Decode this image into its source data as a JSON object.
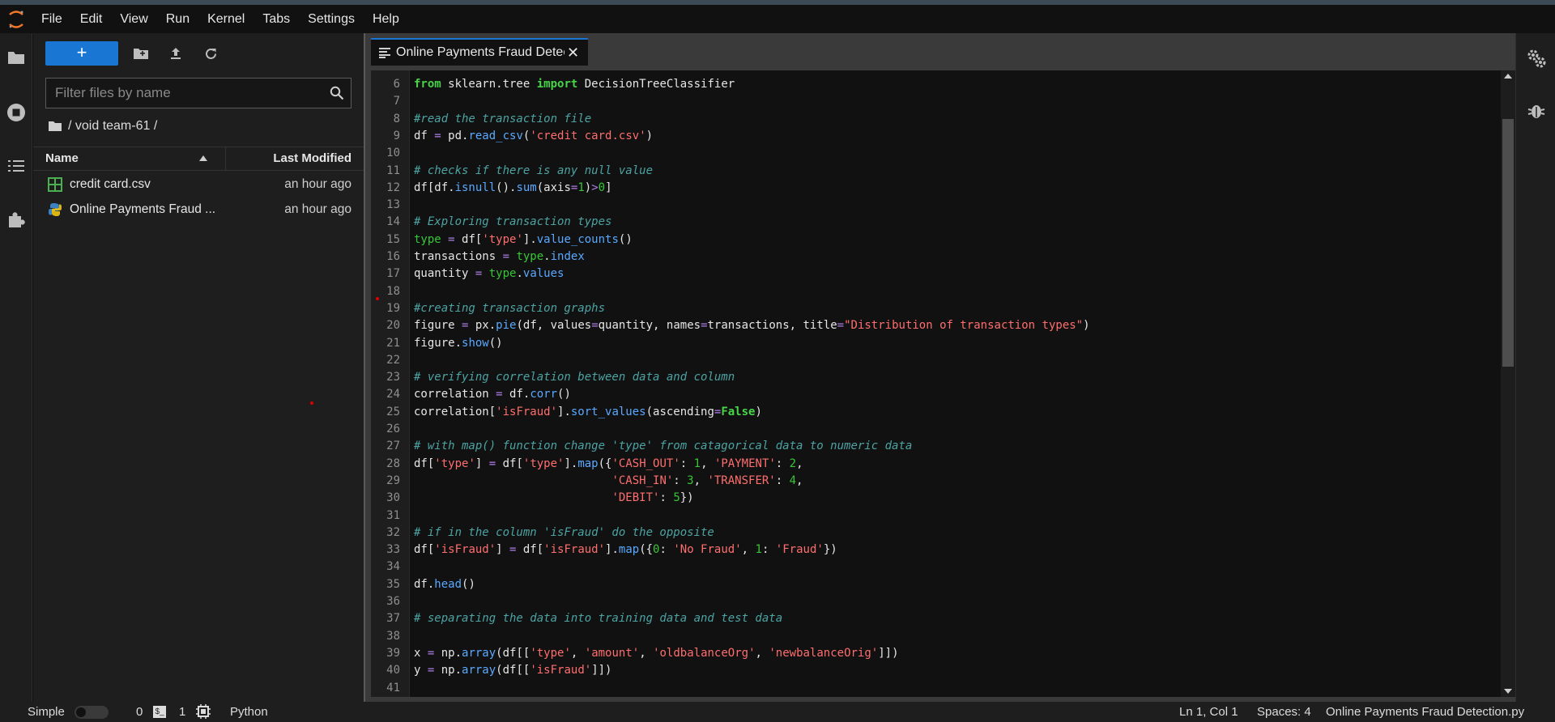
{
  "menubar": {
    "items": [
      "File",
      "Edit",
      "View",
      "Run",
      "Kernel",
      "Tabs",
      "Settings",
      "Help"
    ]
  },
  "filebrowser": {
    "new_label": "+",
    "filter_placeholder": "Filter files by name",
    "breadcrumb": "/ void team-61 /",
    "col_name": "Name",
    "col_modified": "Last Modified",
    "files": [
      {
        "name": "credit card.csv",
        "modified": "an hour ago",
        "icon": "csv-table-icon"
      },
      {
        "name": "Online Payments Fraud ...",
        "modified": "an hour ago",
        "icon": "python-file-icon"
      }
    ]
  },
  "tab": {
    "label": "Online Payments Fraud Detection.py",
    "close": "✕"
  },
  "editor": {
    "lines": [
      {
        "n": "6",
        "html": "<span class=\"kw\">from</span> sklearn.tree <span class=\"kw\">import</span> DecisionTreeClassifier"
      },
      {
        "n": "7",
        "html": ""
      },
      {
        "n": "8",
        "html": "<span class=\"cm\">#read the transaction file</span>"
      },
      {
        "n": "9",
        "html": "df <span class=\"op\">=</span> pd.<span class=\"fn\">read_csv</span>(<span class=\"st\">'credit card.csv'</span>)"
      },
      {
        "n": "10",
        "html": ""
      },
      {
        "n": "11",
        "html": "<span class=\"cm\"># checks if there is any null value</span>"
      },
      {
        "n": "12",
        "html": "df[df.<span class=\"fn\">isnull</span>().<span class=\"fn\">sum</span>(axis<span class=\"op\">=</span><span class=\"nm\">1</span>)<span class=\"op\">&gt;</span><span class=\"nm\">0</span>]"
      },
      {
        "n": "13",
        "html": ""
      },
      {
        "n": "14",
        "html": "<span class=\"cm\"># Exploring transaction types</span>"
      },
      {
        "n": "15",
        "html": "<span class=\"nm\">type</span> <span class=\"op\">=</span> df[<span class=\"st\">'type'</span>].<span class=\"fn\">value_counts</span>()"
      },
      {
        "n": "16",
        "html": "transactions <span class=\"op\">=</span> <span class=\"nm\">type</span>.<span class=\"fn\">index</span>"
      },
      {
        "n": "17",
        "html": "quantity <span class=\"op\">=</span> <span class=\"nm\">type</span>.<span class=\"fn\">values</span>"
      },
      {
        "n": "18",
        "html": ""
      },
      {
        "n": "19",
        "html": "<span class=\"cm\">#creating transaction graphs</span>"
      },
      {
        "n": "20",
        "html": "figure <span class=\"op\">=</span> px.<span class=\"fn\">pie</span>(df, values<span class=\"op\">=</span>quantity, names<span class=\"op\">=</span>transactions, title<span class=\"op\">=</span><span class=\"st\">\"Distribution of transaction types\"</span>)"
      },
      {
        "n": "21",
        "html": "figure.<span class=\"fn\">show</span>()"
      },
      {
        "n": "22",
        "html": ""
      },
      {
        "n": "23",
        "html": "<span class=\"cm\"># verifying correlation between data and column</span>"
      },
      {
        "n": "24",
        "html": "correlation <span class=\"op\">=</span> df.<span class=\"fn\">corr</span>()"
      },
      {
        "n": "25",
        "html": "correlation[<span class=\"st\">'isFraud'</span>].<span class=\"fn\">sort_values</span>(ascending<span class=\"op\">=</span><span class=\"kw\">False</span>)"
      },
      {
        "n": "26",
        "html": ""
      },
      {
        "n": "27",
        "html": "<span class=\"cm\"># with map() function change 'type' from catagorical data to numeric data</span>"
      },
      {
        "n": "28",
        "html": "df[<span class=\"st\">'type'</span>] <span class=\"op\">=</span> df[<span class=\"st\">'type'</span>].<span class=\"fn\">map</span>({<span class=\"st\">'CASH_OUT'</span>: <span class=\"nm\">1</span>, <span class=\"st\">'PAYMENT'</span>: <span class=\"nm\">2</span>,"
      },
      {
        "n": "29",
        "html": "                             <span class=\"st\">'CASH_IN'</span>: <span class=\"nm\">3</span>, <span class=\"st\">'TRANSFER'</span>: <span class=\"nm\">4</span>,"
      },
      {
        "n": "30",
        "html": "                             <span class=\"st\">'DEBIT'</span>: <span class=\"nm\">5</span>})"
      },
      {
        "n": "31",
        "html": ""
      },
      {
        "n": "32",
        "html": "<span class=\"cm\"># if in the column 'isFraud' do the opposite</span>"
      },
      {
        "n": "33",
        "html": "df[<span class=\"st\">'isFraud'</span>] <span class=\"op\">=</span> df[<span class=\"st\">'isFraud'</span>].<span class=\"fn\">map</span>({<span class=\"nm\">0</span>: <span class=\"st\">'No Fraud'</span>, <span class=\"nm\">1</span>: <span class=\"st\">'Fraud'</span>})"
      },
      {
        "n": "34",
        "html": ""
      },
      {
        "n": "35",
        "html": "df.<span class=\"fn\">head</span>()"
      },
      {
        "n": "36",
        "html": ""
      },
      {
        "n": "37",
        "html": "<span class=\"cm\"># separating the data into training data and test data</span>"
      },
      {
        "n": "38",
        "html": ""
      },
      {
        "n": "39",
        "html": "x <span class=\"op\">=</span> np.<span class=\"fn\">array</span>(df[[<span class=\"st\">'type'</span>, <span class=\"st\">'amount'</span>, <span class=\"st\">'oldbalanceOrg'</span>, <span class=\"st\">'newbalanceOrig'</span>]])"
      },
      {
        "n": "40",
        "html": "y <span class=\"op\">=</span> np.<span class=\"fn\">array</span>(df[[<span class=\"st\">'isFraud'</span>]])"
      },
      {
        "n": "41",
        "html": ""
      }
    ]
  },
  "statusbar": {
    "mode": "Simple",
    "terminals": "0",
    "kernels": "1",
    "kernel_name": "Python",
    "cursor": "Ln 1, Col 1",
    "spaces": "Spaces: 4",
    "filename": "Online Payments Fraud Detection.py"
  },
  "colors": {
    "accent": "#1976d2",
    "background": "#111111",
    "panel": "#1e1e1e",
    "keyword": "#48d448",
    "comment": "#4da3a3",
    "string": "#ff6e6e",
    "function": "#5aa9ff"
  }
}
